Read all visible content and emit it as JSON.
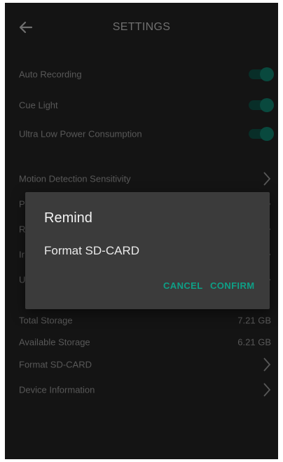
{
  "header": {
    "title": "SETTINGS",
    "back_icon": "arrow-left-icon"
  },
  "toggles": [
    {
      "label": "Auto Recording",
      "on": true
    },
    {
      "label": "Cue Light",
      "on": true
    },
    {
      "label": "Ultra Low Power Consumption",
      "on": true
    }
  ],
  "nav_items": [
    {
      "label": "Motion Detection Sensitivity"
    },
    {
      "label": "P"
    },
    {
      "label": "R"
    },
    {
      "label": "Ir"
    },
    {
      "label": "U"
    }
  ],
  "storage": {
    "total_label": "Total Storage",
    "total_value": "7.21 GB",
    "available_label": "Available Storage",
    "available_value": "6.21 GB"
  },
  "actions": {
    "format_label": "Format SD-CARD",
    "device_info_label": "Device Information"
  },
  "dialog": {
    "title": "Remind",
    "message": "Format SD-CARD",
    "cancel_label": "CANCEL",
    "confirm_label": "CONFIRM"
  },
  "colors": {
    "background": "#191919",
    "dialog_bg": "#3b3b3b",
    "accent": "#0e9f86",
    "toggle_on": "#0c5c4e"
  }
}
